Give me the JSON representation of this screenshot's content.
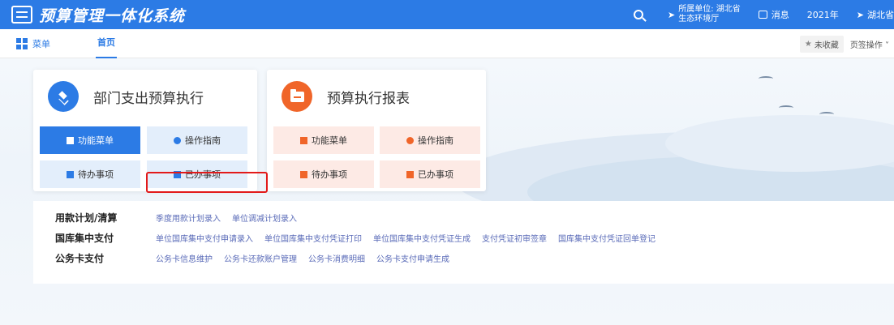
{
  "header": {
    "app_title": "预算管理一体化系统",
    "unit_label": "所属单位: 湖北省",
    "unit_name": "生态环境厅",
    "messages_label": "消息",
    "year": "2021年",
    "region": "湖北省"
  },
  "tabs": {
    "menu_label": "菜单",
    "home_label": "首页",
    "favorite_label": "未收藏",
    "page_ops_label": "页签操作"
  },
  "cards": [
    {
      "title": "部门支出预算执行",
      "color": "#2c7be5",
      "buttons": [
        "功能菜单",
        "操作指南",
        "待办事项",
        "已办事项"
      ]
    },
    {
      "title": "预算执行报表",
      "color": "#f06529",
      "buttons": [
        "功能菜单",
        "操作指南",
        "待办事项",
        "已办事项"
      ]
    }
  ],
  "link_groups": [
    {
      "label": "用款计划/清算",
      "links": [
        "季度用款计划录入",
        "单位调减计划录入"
      ]
    },
    {
      "label": "国库集中支付",
      "links": [
        "单位国库集中支付申请录入",
        "单位国库集中支付凭证打印",
        "单位国库集中支付凭证生成",
        "支付凭证初审签章",
        "国库集中支付凭证回单登记"
      ]
    },
    {
      "label": "公务卡支付",
      "links": [
        "公务卡信息维护",
        "公务卡还款账户管理",
        "公务卡消费明细",
        "公务卡支付申请生成"
      ]
    }
  ],
  "colors": {
    "primary": "#2c7be5",
    "accent": "#f06529",
    "highlight": "#e21a1a"
  }
}
